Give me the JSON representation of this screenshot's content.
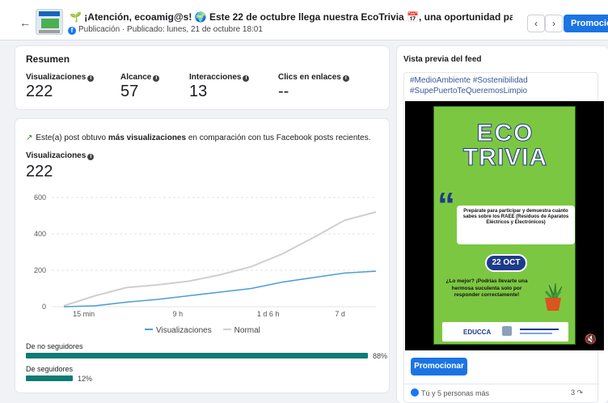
{
  "header": {
    "back_icon": "arrow-left-icon",
    "title": "🌱 ¡Atención, ecoamig@s! 🌍 Este 22 de octubre llega nuestra EcoTrivia 📅, una oportunidad para poner a prueba t...",
    "subtitle": "Publicación · Publicado: lunes, 21 de octubre 18:01",
    "prev_icon": "chevron-left-icon",
    "next_icon": "chevron-right-icon",
    "promote_label": "Promocionar"
  },
  "summary": {
    "title": "Resumen",
    "metrics": [
      {
        "label": "Visualizaciones",
        "value": "222",
        "info": true
      },
      {
        "label": "Alcance",
        "value": "57",
        "info": true
      },
      {
        "label": "Interacciones",
        "value": "13",
        "info": true
      },
      {
        "label": "Clics en enlaces",
        "value": "--",
        "info": true
      }
    ]
  },
  "performance": {
    "insight_pre": "Este(a) post obtuvo ",
    "insight_bold": "más visualizaciones",
    "insight_post": " en comparación con tus Facebook posts recientes.",
    "views_label": "Visualizaciones",
    "views_value": "222",
    "legend": [
      {
        "name": "Visualizaciones",
        "color": "#4a9fd8"
      },
      {
        "name": "Normal",
        "color": "#cfcfcf"
      }
    ],
    "segments": [
      {
        "label": "De no seguidores",
        "percent": 88,
        "percent_label": "88%"
      },
      {
        "label": "De seguidores",
        "percent": 12,
        "percent_label": "12%"
      }
    ]
  },
  "chart_data": {
    "type": "line",
    "x_ticks": [
      "15 min",
      "9 h",
      "1 d 6 h",
      "7 d"
    ],
    "y_ticks": [
      0,
      200,
      400,
      600
    ],
    "ylim": [
      0,
      600
    ],
    "grid": true,
    "legend_position": "bottom",
    "series": [
      {
        "name": "Visualizaciones",
        "color": "#4a9fd8",
        "x": [
          0,
          0.1,
          0.2,
          0.3,
          0.4,
          0.5,
          0.6,
          0.7,
          0.8,
          0.9,
          1.0
        ],
        "values": [
          0,
          5,
          25,
          40,
          60,
          80,
          100,
          135,
          160,
          185,
          195
        ]
      },
      {
        "name": "Normal",
        "color": "#cfcfcf",
        "x": [
          0,
          0.1,
          0.2,
          0.3,
          0.4,
          0.5,
          0.6,
          0.7,
          0.8,
          0.9,
          1.0
        ],
        "values": [
          5,
          60,
          105,
          120,
          140,
          175,
          220,
          290,
          380,
          475,
          520
        ]
      }
    ]
  },
  "preview": {
    "title": "Vista previa del feed",
    "hashtags": "#MedioAmbiente #Sostenibilidad #SupePuertoTeQueremosLimpio",
    "poster": {
      "title_line1": "ECO",
      "title_line2": "TRIVIA",
      "bubble_text": "Prepárate para participar y demuestra cuánto sabes sobre los RAEE (Residuos de Aparatos Eléctricos y Electrónicos)",
      "date": "22 OCT",
      "bottom_text": "¿Lo mejor? ¡Podrías llevarte una hermosa suculenta solo por responder correctamente!",
      "logo_text": "EDUCCA",
      "plant_icon": "succulent-plant-icon",
      "quote_icon": "quote-mark-icon"
    },
    "mute_icon": "volume-muted-icon",
    "promote_label": "Promocionar",
    "reactions": "Tú y 5 personas más",
    "shares": "3"
  }
}
